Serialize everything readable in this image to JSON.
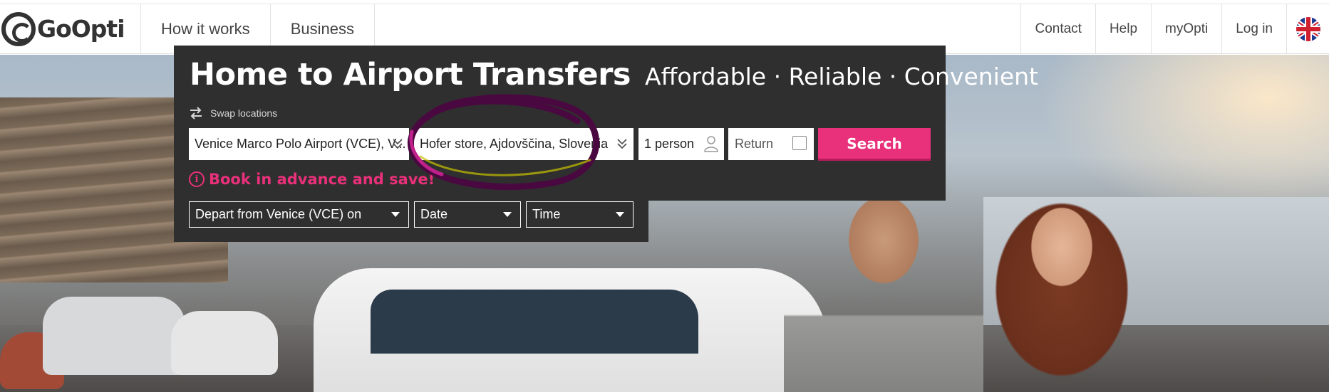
{
  "brand": {
    "logo_text": "GoOpti"
  },
  "nav": {
    "left": [
      {
        "label": "How it works"
      },
      {
        "label": "Business"
      }
    ],
    "right": [
      {
        "label": "Contact"
      },
      {
        "label": "Help"
      },
      {
        "label": "myOpti"
      },
      {
        "label": "Log in"
      }
    ],
    "language_icon": "uk-flag-icon"
  },
  "search": {
    "title": "Home to Airport Transfers",
    "tagline": "Affordable · Reliable · Convenient",
    "swap_label": "Swap locations",
    "from_value": "Venice Marco Polo Airport (VCE), V...",
    "to_value": "Hofer store, Ajdovščina, Slovenia",
    "passengers_value": "1 person",
    "return_label": "Return",
    "return_checked": false,
    "search_button": "Search",
    "notice": "Book in advance and save!",
    "depart_select": "Depart from Venice (VCE) on",
    "date_select": "Date",
    "time_select": "Time"
  },
  "colors": {
    "accent": "#e9307a",
    "panel": "#2f2f2f",
    "annotation_circle": "#5a0a4a"
  }
}
